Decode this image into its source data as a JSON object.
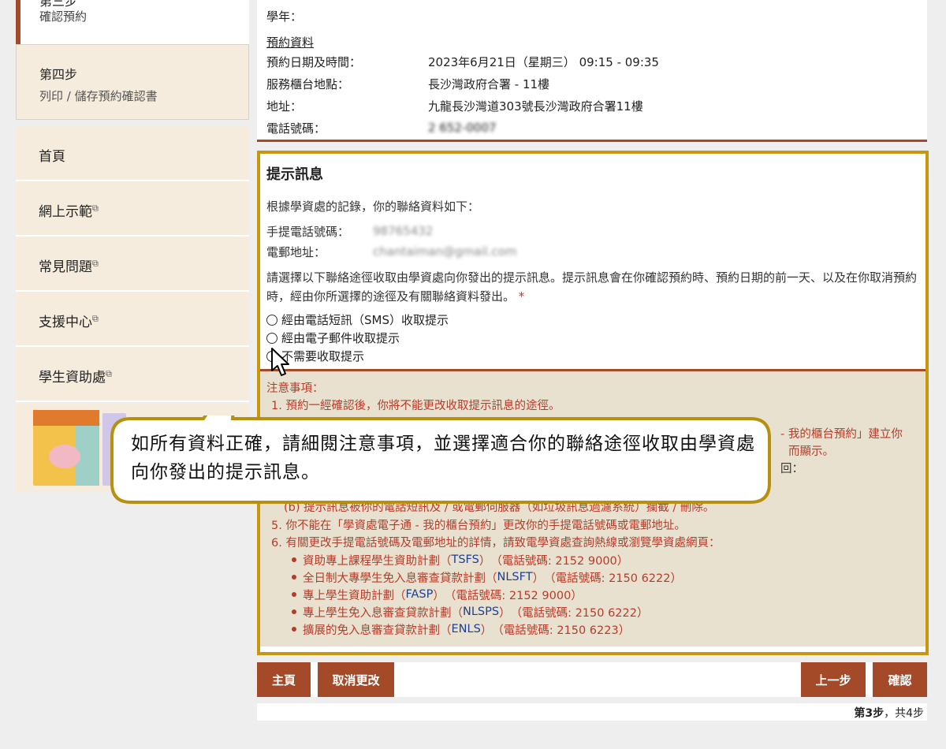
{
  "sidebar": {
    "step3": {
      "num": "第三步",
      "sub": "確認預約"
    },
    "step4": {
      "num": "第四步",
      "sub": "列印 / 儲存預約確認書"
    },
    "nav": [
      {
        "label": "首頁",
        "ext": ""
      },
      {
        "label": "網上示範",
        "ext": "⧉"
      },
      {
        "label": "常見問題",
        "ext": "⧉"
      },
      {
        "label": "支援中心",
        "ext": "⧉"
      },
      {
        "label": "學生資助處",
        "ext": "⧉"
      }
    ]
  },
  "info": {
    "academic_year_label": "學年：",
    "section_title": "預約資料",
    "rows": [
      {
        "label": "預約日期及時間：",
        "value": "2023年6月21日（星期三） 09:15 - 09:35"
      },
      {
        "label": "服務櫃台地點：",
        "value": "長沙灣政府合署 - 11樓"
      },
      {
        "label": "地址：",
        "value": "九龍長沙灣道303號長沙灣政府合署11樓"
      },
      {
        "label": "電話號碼：",
        "value": "2 652-0007"
      }
    ]
  },
  "notice": {
    "title": "提示訊息",
    "intro": "根據學資處的記錄，你的聯絡資料如下：",
    "mobile_label": "手提電話號碼：",
    "mobile_value": "98765432",
    "email_label": "電郵地址：",
    "email_value": "chantaiman@gmail.com",
    "instruction": "請選擇以下聯絡途徑收取由學資處向你發出的提示訊息。提示訊息會在你確認預約時、預約日期的前一天、以及在你取消預約時，經由你所選擇的途徑及有關聯絡資料發出。",
    "required_mark": "*",
    "options": [
      "經由電話短訊（SMS）收取提示",
      "經由電子郵件收取提示",
      "不需要收取提示"
    ]
  },
  "notes": {
    "title": "注意事項：",
    "n1": "1. 預約一經確認後，你將不能更改收取提示訊息的途徑。",
    "right1": "- 我的櫃台預約」建立你",
    "right2": "而顯示。",
    "right3": "回：",
    "sub_b": "(b)  提示訊息被你的電話短訊及 / 或電郵伺服器（如垃圾訊息過濾系統）攔截 / 刪除。",
    "n5": "5. 你不能在「學資處電子通 - 我的櫃台預約」更改你的手提電話號碼或電郵地址。",
    "n6": "6. 有關更改手提電話號碼及電郵地址的詳情，請致電學資處查詢熱線或瀏覽學資處網頁：",
    "schemes": [
      {
        "name": "資助專上課程學生資助計劃",
        "abbr": "TSFS",
        "phone": "（電話號碼: 2152 9000）"
      },
      {
        "name": "全日制大專學生免入息審查貸款計劃",
        "abbr": "NLSFT",
        "phone": "（電話號碼: 2150 6222）"
      },
      {
        "name": "專上學生資助計劃",
        "abbr": "FASP",
        "phone": "（電話號碼: 2152 9000）"
      },
      {
        "name": "專上學生免入息審查貸款計劃",
        "abbr": "NLSPS",
        "phone": "（電話號碼: 2150 6222）"
      },
      {
        "name": "擴展的免入息審查貸款計劃",
        "abbr": "ENLS",
        "phone": "（電話號碼: 2150 6223）"
      }
    ]
  },
  "buttons": {
    "home": "主頁",
    "cancel": "取消更改",
    "prev": "上一步",
    "confirm": "確認"
  },
  "step_counter": {
    "current": "第3步",
    "rest": "，共4步"
  },
  "callout": {
    "text": "如所有資料正確，請細閱注意事項，並選擇適合你的聯絡途徑收取由學資處向你發出的提示訊息。"
  },
  "colors": {
    "brand": "#a44a29",
    "highlight_border": "#c9970f",
    "notes_bg": "#e9e1cf",
    "notes_text": "#b73b2a",
    "link_blue": "#1f3f8f"
  }
}
